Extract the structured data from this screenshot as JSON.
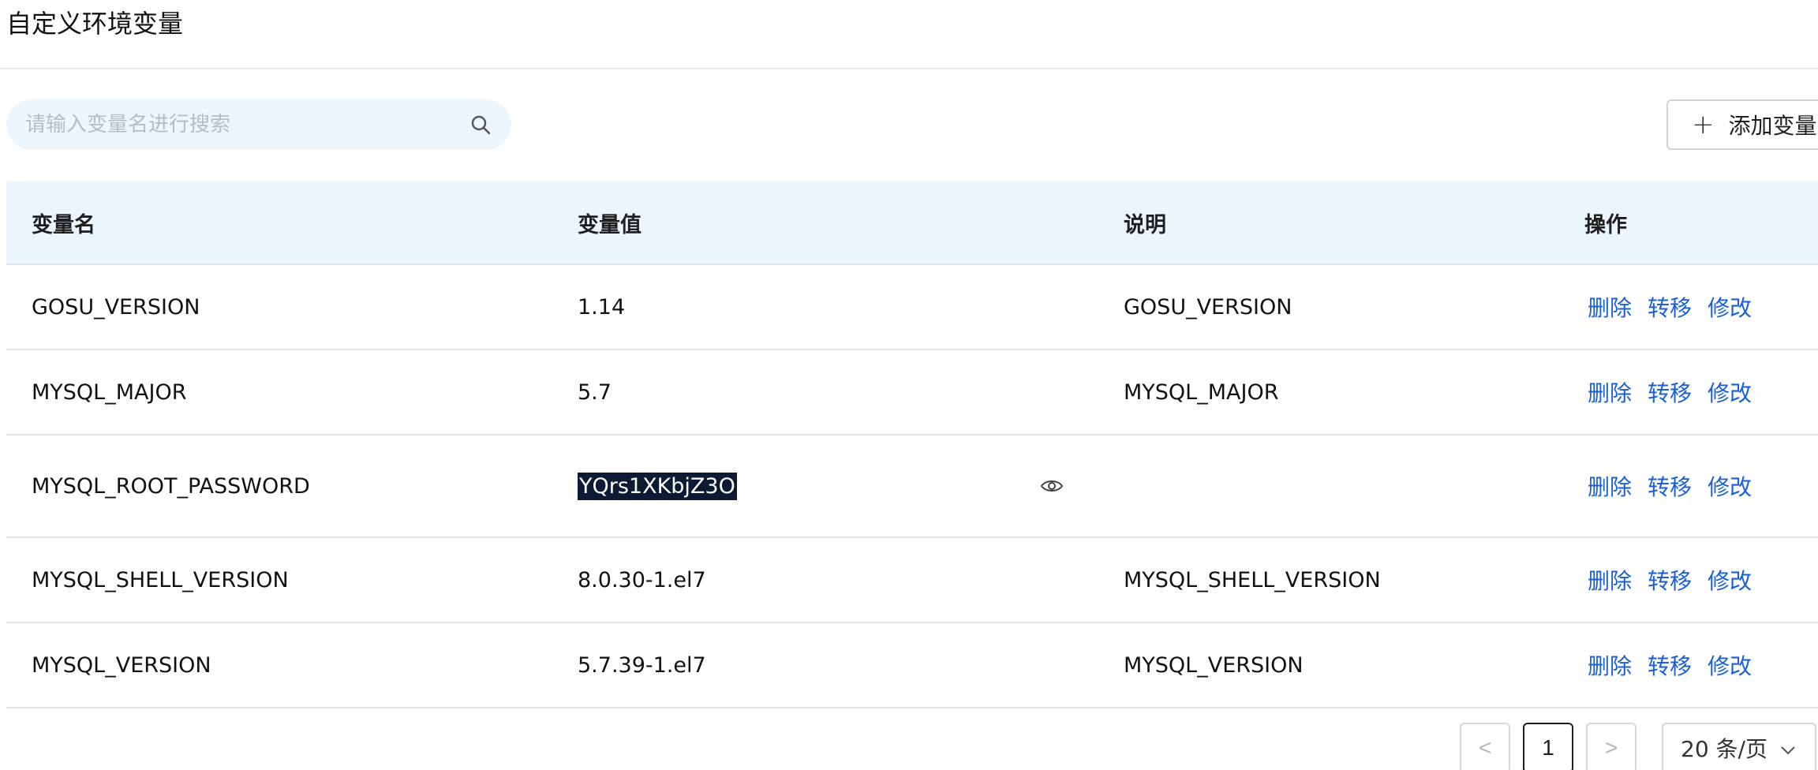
{
  "section": {
    "title": "自定义环境变量"
  },
  "search": {
    "placeholder": "请输入变量名进行搜索",
    "value": ""
  },
  "toolbar": {
    "add_label": "添加变量"
  },
  "table": {
    "headers": {
      "name": "变量名",
      "value": "变量值",
      "description": "说明",
      "actions": "操作"
    },
    "action_labels": {
      "delete": "删除",
      "transfer": "转移",
      "edit": "修改"
    },
    "rows": [
      {
        "name": "GOSU_VERSION",
        "value": "1.14",
        "description": "GOSU_VERSION"
      },
      {
        "name": "MYSQL_MAJOR",
        "value": "5.7",
        "description": "MYSQL_MAJOR"
      },
      {
        "name": "MYSQL_ROOT_PASSWORD",
        "value": "YQrs1XKbjZ3O",
        "description": ""
      },
      {
        "name": "MYSQL_SHELL_VERSION",
        "value": "8.0.30-1.el7",
        "description": "MYSQL_SHELL_VERSION"
      },
      {
        "name": "MYSQL_VERSION",
        "value": "5.7.39-1.el7",
        "description": "MYSQL_VERSION"
      }
    ]
  },
  "pagination": {
    "prev": "<",
    "current_page": "1",
    "next": ">",
    "page_size": "20 条/页"
  },
  "icons": {
    "search": "search-icon",
    "plus": "plus-icon",
    "eye": "eye-icon",
    "chevron": "chevron-down-icon"
  },
  "colors": {
    "link": "#1a5fd6",
    "header_bg": "#ebf5fc",
    "search_bg": "#eef6fd",
    "selection_bg": "#0d1a33"
  }
}
